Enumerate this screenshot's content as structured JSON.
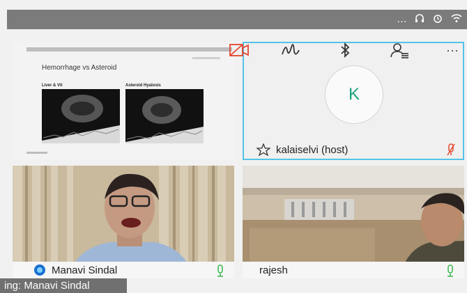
{
  "toolbar": {
    "icons": [
      "video-off-icon",
      "annotate-icon",
      "bluetooth-icon",
      "participants-icon",
      "more-icon"
    ],
    "more_label": "···"
  },
  "slide": {
    "title": "Hemorrhage vs Asteroid",
    "left_label": "Liver & Vit",
    "right_label": "Asteroid Hyalosis"
  },
  "host_tile": {
    "avatar_letter": "K",
    "name": "kalaiselvi (host)"
  },
  "participants": [
    {
      "name": "Manavi Sindal"
    },
    {
      "name": "rajesh"
    }
  ],
  "speaking": "ing: Manavi Sindal",
  "colors": {
    "host_border": "#53c3e6",
    "avatar_text": "#1aa47b",
    "mic_green": "#39b54a",
    "muted_red": "#e2462f"
  }
}
